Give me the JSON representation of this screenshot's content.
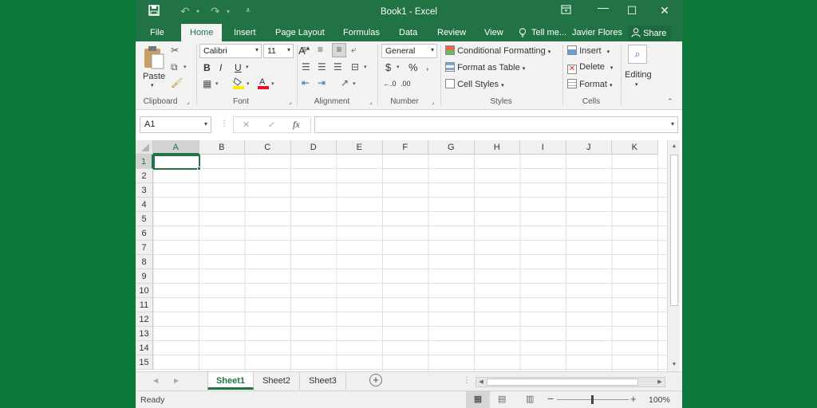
{
  "titlebar": {
    "title": "Book1 - Excel",
    "save_icon": "save-icon",
    "undo_icon": "undo-icon",
    "redo_icon": "redo-icon",
    "customize_icon": "customize-qat-icon",
    "restore_icon": "ribbon-display-icon",
    "minimize_icon": "minimize-icon",
    "maximize_icon": "maximize-icon",
    "close_icon": "close-icon"
  },
  "tabs": {
    "file": "File",
    "home": "Home",
    "insert": "Insert",
    "page_layout": "Page Layout",
    "formulas": "Formulas",
    "data": "Data",
    "review": "Review",
    "view": "View",
    "tell_me": "Tell me...",
    "user": "Javier Flores",
    "share": "Share"
  },
  "ribbon": {
    "clipboard": {
      "paste": "Paste",
      "label": "Clipboard"
    },
    "font": {
      "name": "Calibri",
      "size": "11",
      "bold": "B",
      "italic": "I",
      "underline": "U",
      "label": "Font"
    },
    "alignment": {
      "label": "Alignment"
    },
    "number": {
      "format": "General",
      "currency": "$",
      "percent": "%",
      "comma": ",",
      "inc_dec": "←.0",
      "dec_dec": ".00",
      "label": "Number"
    },
    "styles": {
      "conditional": "Conditional Formatting",
      "table": "Format as Table",
      "cell_styles": "Cell Styles",
      "label": "Styles"
    },
    "cells": {
      "insert": "Insert",
      "delete": "Delete",
      "format": "Format",
      "label": "Cells"
    },
    "editing": {
      "label": "Editing"
    }
  },
  "formula_bar": {
    "name_box": "A1",
    "cancel": "✕",
    "enter": "✓",
    "fx": "fx",
    "value": ""
  },
  "columns": [
    "A",
    "B",
    "C",
    "D",
    "E",
    "F",
    "G",
    "H",
    "I",
    "J",
    "K"
  ],
  "rows": [
    "1",
    "2",
    "3",
    "4",
    "5",
    "6",
    "7",
    "8",
    "9",
    "10",
    "11",
    "12",
    "13",
    "14",
    "15"
  ],
  "sheets": [
    "Sheet1",
    "Sheet2",
    "Sheet3"
  ],
  "status": {
    "text": "Ready",
    "zoom": "100%"
  },
  "colors": {
    "accent": "#217346",
    "background": "#0d7a3c"
  }
}
